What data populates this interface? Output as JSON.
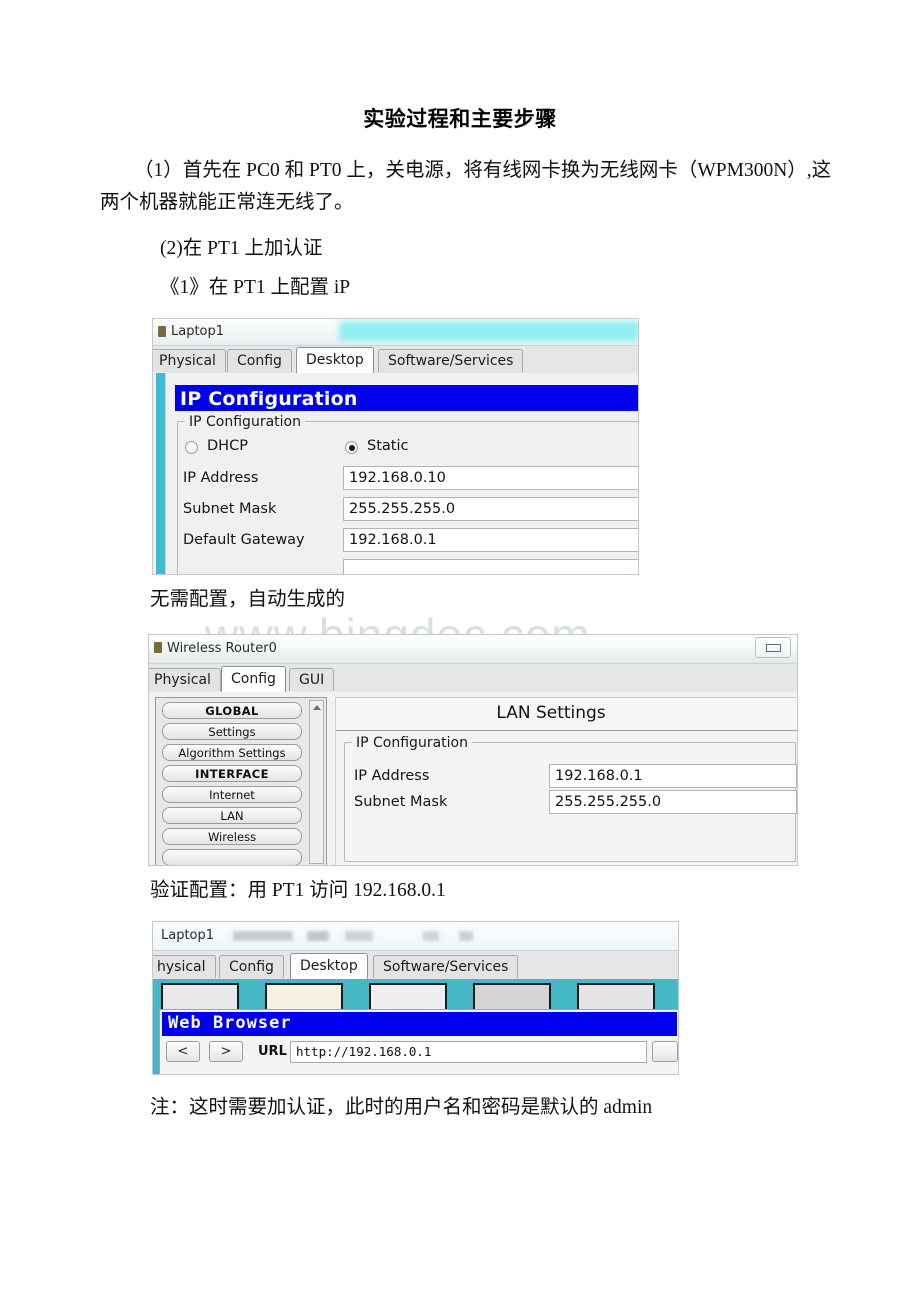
{
  "document": {
    "title": "实验过程和主要步骤",
    "paragraphs": {
      "p1": "（1）首先在 PC0 和 PT0 上，关电源，将有线网卡换为无线网卡（WPM300N）,这两个机器就能正常连无线了。",
      "p2": "(2)在 PT1 上加认证",
      "p3": "《1》在 PT1 上配置 iP",
      "p4": "无需配置，自动生成的",
      "p5": "验证配置：用 PT1 访问 192.168.0.1",
      "p6": "注：这时需要加认证，此时的用户名和密码是默认的 admin"
    },
    "watermark": "www.bingdoc.com"
  },
  "screenshot_laptop_ip": {
    "window_title": "Laptop1",
    "tabs": [
      {
        "label": "Physical",
        "active": false
      },
      {
        "label": "Config",
        "active": false
      },
      {
        "label": "Desktop",
        "active": true
      },
      {
        "label": "Software/Services",
        "active": false
      }
    ],
    "panel_title": "IP Configuration",
    "group_label": "IP Configuration",
    "radios": [
      {
        "label": "DHCP",
        "checked": false
      },
      {
        "label": "Static",
        "checked": true
      }
    ],
    "fields": [
      {
        "label": "IP Address",
        "value": "192.168.0.10"
      },
      {
        "label": "Subnet Mask",
        "value": "255.255.255.0"
      },
      {
        "label": "Default Gateway",
        "value": "192.168.0.1"
      }
    ],
    "accent_color": "#3cbcd0",
    "title_color": "#0000ee"
  },
  "screenshot_router": {
    "window_title": "Wireless Router0",
    "minimize_label": "",
    "tabs": [
      {
        "label": "Physical",
        "active": false
      },
      {
        "label": "Config",
        "active": true
      },
      {
        "label": "GUI",
        "active": false
      }
    ],
    "rail": [
      {
        "label": "GLOBAL",
        "header": true
      },
      {
        "label": "Settings",
        "header": false
      },
      {
        "label": "Algorithm Settings",
        "header": false
      },
      {
        "label": "INTERFACE",
        "header": true
      },
      {
        "label": "Internet",
        "header": false
      },
      {
        "label": "LAN",
        "header": false
      },
      {
        "label": "Wireless",
        "header": false
      }
    ],
    "panel_title": "LAN Settings",
    "group_label": "IP Configuration",
    "fields": [
      {
        "label": "IP Address",
        "value": "192.168.0.1"
      },
      {
        "label": "Subnet Mask",
        "value": "255.255.255.0"
      }
    ]
  },
  "screenshot_browser": {
    "window_title": "Laptop1",
    "tabs": [
      {
        "label": "hysical",
        "active": false
      },
      {
        "label": "Config",
        "active": false
      },
      {
        "label": "Desktop",
        "active": true
      },
      {
        "label": "Software/Services",
        "active": false
      }
    ],
    "panel_title": "Web Browser",
    "back_label": "<",
    "forward_label": ">",
    "url_label": "URL",
    "url_value": "http://192.168.0.1",
    "desktop_bg": "#45b8c8",
    "title_color": "#0000ee"
  }
}
